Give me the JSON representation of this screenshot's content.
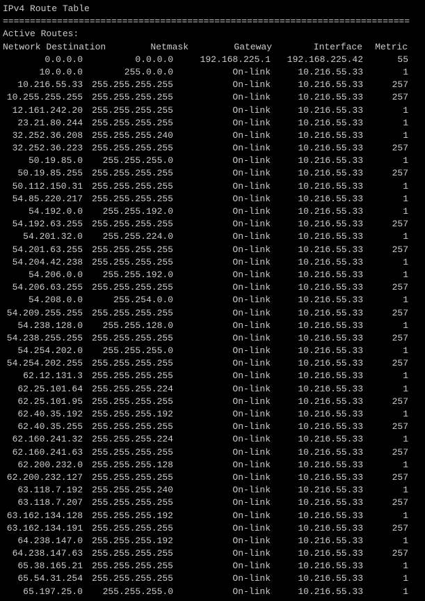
{
  "title": "IPv4 Route Table",
  "divider": "===========================================================================",
  "subtitle": "Active Routes:",
  "headers": {
    "destination": "Network Destination",
    "netmask": "Netmask",
    "gateway": "Gateway",
    "interface": "Interface",
    "metric": "Metric"
  },
  "routes": [
    {
      "dest": "0.0.0.0",
      "mask": "0.0.0.0",
      "gate": "192.168.225.1",
      "iface": "192.168.225.42",
      "metric": "55"
    },
    {
      "dest": "10.0.0.0",
      "mask": "255.0.0.0",
      "gate": "On-link",
      "iface": "10.216.55.33",
      "metric": "1"
    },
    {
      "dest": "10.216.55.33",
      "mask": "255.255.255.255",
      "gate": "On-link",
      "iface": "10.216.55.33",
      "metric": "257"
    },
    {
      "dest": "10.255.255.255",
      "mask": "255.255.255.255",
      "gate": "On-link",
      "iface": "10.216.55.33",
      "metric": "257"
    },
    {
      "dest": "12.161.242.20",
      "mask": "255.255.255.255",
      "gate": "On-link",
      "iface": "10.216.55.33",
      "metric": "1"
    },
    {
      "dest": "23.21.80.244",
      "mask": "255.255.255.255",
      "gate": "On-link",
      "iface": "10.216.55.33",
      "metric": "1"
    },
    {
      "dest": "32.252.36.208",
      "mask": "255.255.255.240",
      "gate": "On-link",
      "iface": "10.216.55.33",
      "metric": "1"
    },
    {
      "dest": "32.252.36.223",
      "mask": "255.255.255.255",
      "gate": "On-link",
      "iface": "10.216.55.33",
      "metric": "257"
    },
    {
      "dest": "50.19.85.0",
      "mask": "255.255.255.0",
      "gate": "On-link",
      "iface": "10.216.55.33",
      "metric": "1"
    },
    {
      "dest": "50.19.85.255",
      "mask": "255.255.255.255",
      "gate": "On-link",
      "iface": "10.216.55.33",
      "metric": "257"
    },
    {
      "dest": "50.112.150.31",
      "mask": "255.255.255.255",
      "gate": "On-link",
      "iface": "10.216.55.33",
      "metric": "1"
    },
    {
      "dest": "54.85.220.217",
      "mask": "255.255.255.255",
      "gate": "On-link",
      "iface": "10.216.55.33",
      "metric": "1"
    },
    {
      "dest": "54.192.0.0",
      "mask": "255.255.192.0",
      "gate": "On-link",
      "iface": "10.216.55.33",
      "metric": "1"
    },
    {
      "dest": "54.192.63.255",
      "mask": "255.255.255.255",
      "gate": "On-link",
      "iface": "10.216.55.33",
      "metric": "257"
    },
    {
      "dest": "54.201.32.0",
      "mask": "255.255.224.0",
      "gate": "On-link",
      "iface": "10.216.55.33",
      "metric": "1"
    },
    {
      "dest": "54.201.63.255",
      "mask": "255.255.255.255",
      "gate": "On-link",
      "iface": "10.216.55.33",
      "metric": "257"
    },
    {
      "dest": "54.204.42.238",
      "mask": "255.255.255.255",
      "gate": "On-link",
      "iface": "10.216.55.33",
      "metric": "1"
    },
    {
      "dest": "54.206.0.0",
      "mask": "255.255.192.0",
      "gate": "On-link",
      "iface": "10.216.55.33",
      "metric": "1"
    },
    {
      "dest": "54.206.63.255",
      "mask": "255.255.255.255",
      "gate": "On-link",
      "iface": "10.216.55.33",
      "metric": "257"
    },
    {
      "dest": "54.208.0.0",
      "mask": "255.254.0.0",
      "gate": "On-link",
      "iface": "10.216.55.33",
      "metric": "1"
    },
    {
      "dest": "54.209.255.255",
      "mask": "255.255.255.255",
      "gate": "On-link",
      "iface": "10.216.55.33",
      "metric": "257"
    },
    {
      "dest": "54.238.128.0",
      "mask": "255.255.128.0",
      "gate": "On-link",
      "iface": "10.216.55.33",
      "metric": "1"
    },
    {
      "dest": "54.238.255.255",
      "mask": "255.255.255.255",
      "gate": "On-link",
      "iface": "10.216.55.33",
      "metric": "257"
    },
    {
      "dest": "54.254.202.0",
      "mask": "255.255.255.0",
      "gate": "On-link",
      "iface": "10.216.55.33",
      "metric": "1"
    },
    {
      "dest": "54.254.202.255",
      "mask": "255.255.255.255",
      "gate": "On-link",
      "iface": "10.216.55.33",
      "metric": "257"
    },
    {
      "dest": "62.12.131.3",
      "mask": "255.255.255.255",
      "gate": "On-link",
      "iface": "10.216.55.33",
      "metric": "1"
    },
    {
      "dest": "62.25.101.64",
      "mask": "255.255.255.224",
      "gate": "On-link",
      "iface": "10.216.55.33",
      "metric": "1"
    },
    {
      "dest": "62.25.101.95",
      "mask": "255.255.255.255",
      "gate": "On-link",
      "iface": "10.216.55.33",
      "metric": "257"
    },
    {
      "dest": "62.40.35.192",
      "mask": "255.255.255.192",
      "gate": "On-link",
      "iface": "10.216.55.33",
      "metric": "1"
    },
    {
      "dest": "62.40.35.255",
      "mask": "255.255.255.255",
      "gate": "On-link",
      "iface": "10.216.55.33",
      "metric": "257"
    },
    {
      "dest": "62.160.241.32",
      "mask": "255.255.255.224",
      "gate": "On-link",
      "iface": "10.216.55.33",
      "metric": "1"
    },
    {
      "dest": "62.160.241.63",
      "mask": "255.255.255.255",
      "gate": "On-link",
      "iface": "10.216.55.33",
      "metric": "257"
    },
    {
      "dest": "62.200.232.0",
      "mask": "255.255.255.128",
      "gate": "On-link",
      "iface": "10.216.55.33",
      "metric": "1"
    },
    {
      "dest": "62.200.232.127",
      "mask": "255.255.255.255",
      "gate": "On-link",
      "iface": "10.216.55.33",
      "metric": "257"
    },
    {
      "dest": "63.118.7.192",
      "mask": "255.255.255.240",
      "gate": "On-link",
      "iface": "10.216.55.33",
      "metric": "1"
    },
    {
      "dest": "63.118.7.207",
      "mask": "255.255.255.255",
      "gate": "On-link",
      "iface": "10.216.55.33",
      "metric": "257"
    },
    {
      "dest": "63.162.134.128",
      "mask": "255.255.255.192",
      "gate": "On-link",
      "iface": "10.216.55.33",
      "metric": "1"
    },
    {
      "dest": "63.162.134.191",
      "mask": "255.255.255.255",
      "gate": "On-link",
      "iface": "10.216.55.33",
      "metric": "257"
    },
    {
      "dest": "64.238.147.0",
      "mask": "255.255.255.192",
      "gate": "On-link",
      "iface": "10.216.55.33",
      "metric": "1"
    },
    {
      "dest": "64.238.147.63",
      "mask": "255.255.255.255",
      "gate": "On-link",
      "iface": "10.216.55.33",
      "metric": "257"
    },
    {
      "dest": "65.38.165.21",
      "mask": "255.255.255.255",
      "gate": "On-link",
      "iface": "10.216.55.33",
      "metric": "1"
    },
    {
      "dest": "65.54.31.254",
      "mask": "255.255.255.255",
      "gate": "On-link",
      "iface": "10.216.55.33",
      "metric": "1"
    },
    {
      "dest": "65.197.25.0",
      "mask": "255.255.255.0",
      "gate": "On-link",
      "iface": "10.216.55.33",
      "metric": "1"
    }
  ]
}
